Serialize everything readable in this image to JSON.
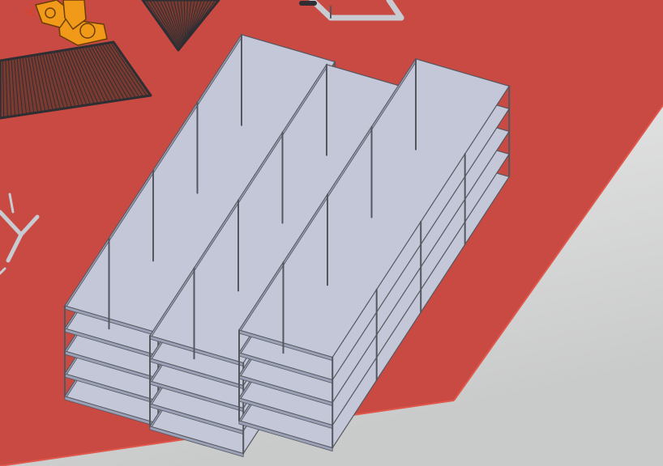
{
  "scene": {
    "colors": {
      "background_top": "#f4f4f4",
      "background_bottom": "#c9caca",
      "floor": "#c84a42",
      "floor_edge": "#e0574c",
      "rack_shelf": "#c3c7d8",
      "rack_shelf_dark": "#9aa0b5",
      "rack_frame": "#55575f",
      "conveyor": "#7a3a30",
      "conveyor_dark": "#2e2e33",
      "robot": "#f19a1a",
      "robot_dark": "#6b3d05",
      "steel": "#c8ccd2"
    },
    "objects": {
      "floor": "floor-plate",
      "racks": "shelving-rack",
      "robot": "industrial-robot-arm",
      "conveyor": "roller-conveyor",
      "frame": "steel-gantry-frame",
      "stand": "tripod-stand"
    }
  }
}
